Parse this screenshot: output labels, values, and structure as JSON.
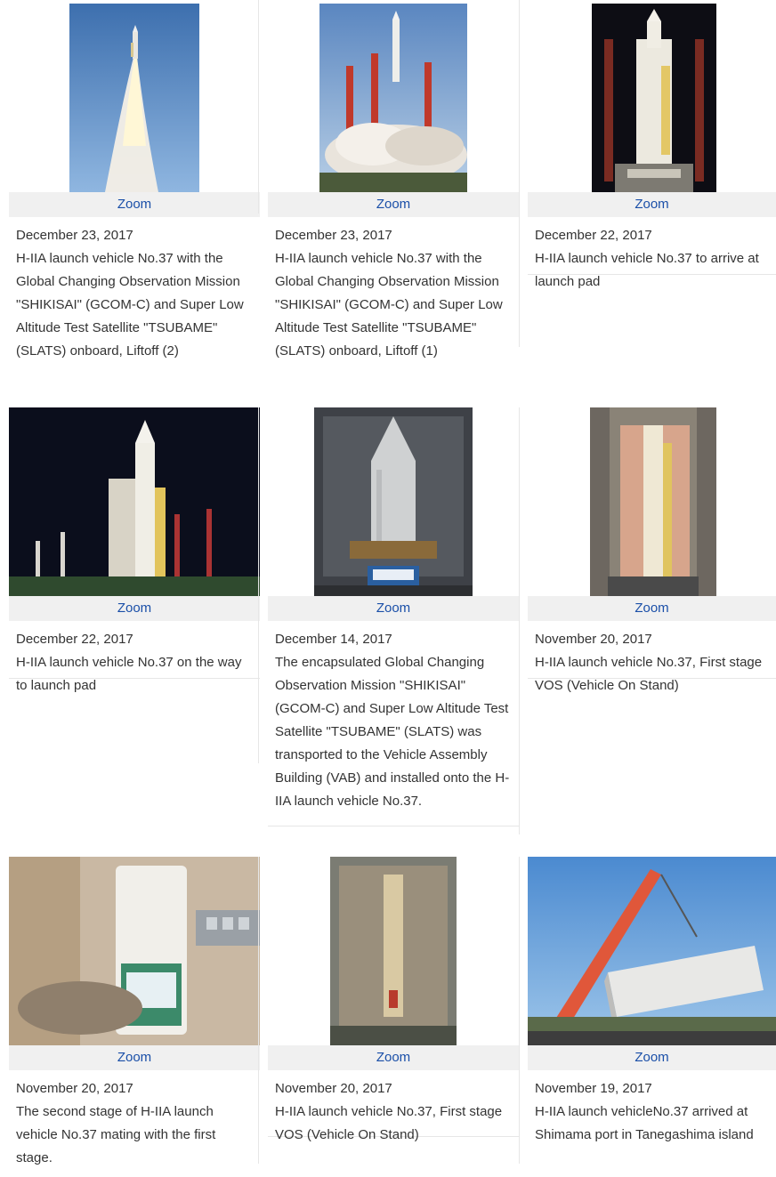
{
  "zoom_label": "Zoom",
  "cards": [
    {
      "date": "December 23, 2017",
      "text": "H-IIA launch vehicle No.37 with the Global Changing Observation Mission \"SHIKISAI\" (GCOM-C) and Super Low Altitude Test Satellite \"TSUBAME\" (SLATS) onboard, Liftoff (2)",
      "image": "rocket-liftoff-2-photo"
    },
    {
      "date": "December 23, 2017",
      "text": "H-IIA launch vehicle No.37 with the Global Changing Observation Mission \"SHIKISAI\" (GCOM-C) and Super Low Altitude Test Satellite \"TSUBAME\" (SLATS) onboard, Liftoff (1)",
      "image": "rocket-liftoff-1-photo"
    },
    {
      "date": "December 22, 2017",
      "text": "H-IIA launch vehicle No.37 to arrive at launch pad",
      "image": "rocket-on-pad-night-photo"
    },
    {
      "date": "December 22, 2017",
      "text": "H-IIA launch vehicle No.37 on the way to launch pad",
      "image": "rocket-transport-night-photo"
    },
    {
      "date": "December 14, 2017",
      "text": "The encapsulated  Global Changing Observation Mission \"SHIKISAI\" (GCOM-C) and Super Low Altitude Test Satellite \"TSUBAME\" (SLATS) was transported to the Vehicle Assembly Building (VAB) and installed onto the H-IIA launch vehicle No.37.",
      "image": "fairing-installation-photo"
    },
    {
      "date": "November 20, 2017",
      "text": "H-IIA launch vehicle No.37, First stage VOS (Vehicle On Stand)",
      "image": "first-stage-vos-photo-1"
    },
    {
      "date": "November 20, 2017",
      "text": "The second stage of H-IIA launch vehicle No.37 mating with the first stage.",
      "image": "second-stage-mating-photo"
    },
    {
      "date": "November 20, 2017",
      "text": "H-IIA launch vehicle No.37, First stage VOS (Vehicle On Stand)",
      "image": "first-stage-vos-photo-2"
    },
    {
      "date": "November 19, 2017",
      "text": "H-IIA launch vehicleNo.37 arrived at Shimama port in Tanegashima island",
      "image": "crane-unloading-photo"
    }
  ]
}
